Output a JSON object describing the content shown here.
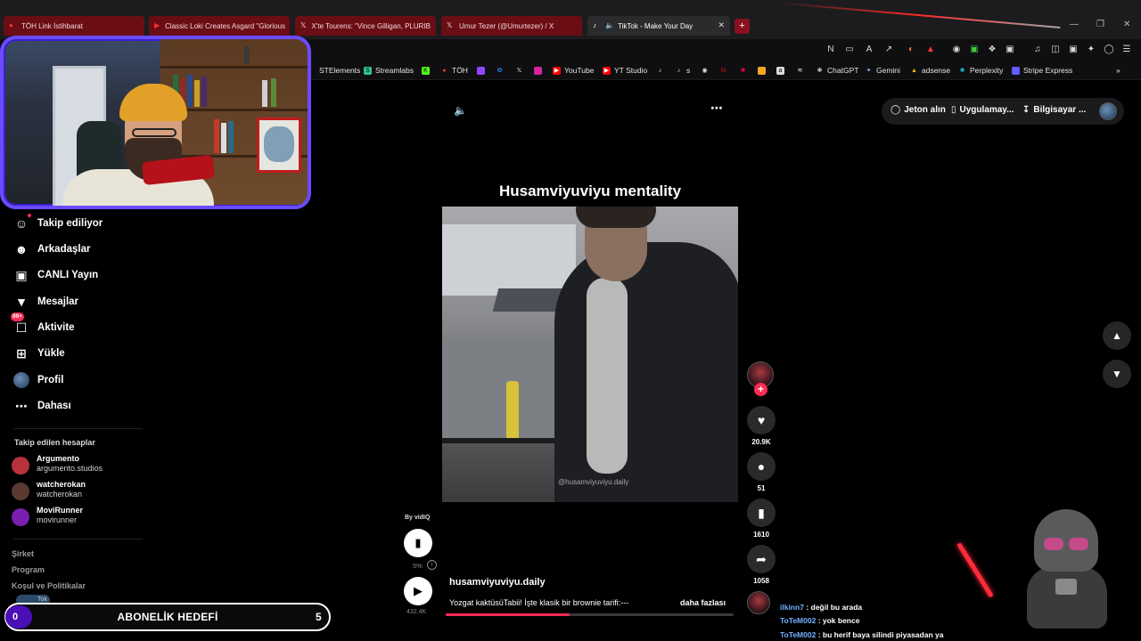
{
  "browser": {
    "tabs": [
      {
        "label": "TÖH Link İstihbarat",
        "icon": "tab-favicon"
      },
      {
        "label": "Classic Loki Creates Asgard \"Glorious",
        "icon": "youtube"
      },
      {
        "label": "X'te Tourens: \"Vince Gilligan, PLURIB",
        "icon": "x"
      },
      {
        "label": "Umur Tezer (@Umurtezer) / X",
        "icon": "x"
      },
      {
        "label": "TikTok - Make Your Day",
        "icon": "tiktok",
        "active": true
      }
    ],
    "bookmarks": [
      {
        "label": "STElements"
      },
      {
        "label": "Streamlabs"
      },
      {
        "label": ""
      },
      {
        "label": "TÖH"
      },
      {
        "label": ""
      },
      {
        "label": ""
      },
      {
        "label": ""
      },
      {
        "label": ""
      },
      {
        "label": "YouTube"
      },
      {
        "label": "YT Studio"
      },
      {
        "label": ""
      },
      {
        "label": "s"
      },
      {
        "label": ""
      },
      {
        "label": ""
      },
      {
        "label": ""
      },
      {
        "label": ""
      },
      {
        "label": ""
      },
      {
        "label": ""
      },
      {
        "label": "ChatGPT"
      },
      {
        "label": "Gemini"
      },
      {
        "label": "adsense"
      },
      {
        "label": "Perplexity"
      },
      {
        "label": "Stripe Express"
      }
    ]
  },
  "tiktok": {
    "header": {
      "coins": "Jeton alın",
      "app": "Uygulamay...",
      "desktop": "Bilgisayar ..."
    },
    "nav": [
      {
        "label": "Takip ediliyor",
        "icon": "following-icon"
      },
      {
        "label": "Arkadaşlar",
        "icon": "friends-icon"
      },
      {
        "label": "CANLI Yayın",
        "icon": "live-icon"
      },
      {
        "label": "Mesajlar",
        "icon": "messages-icon"
      },
      {
        "label": "Aktivite",
        "icon": "activity-icon",
        "badge": "99+"
      },
      {
        "label": "Yükle",
        "icon": "upload-icon"
      },
      {
        "label": "Profil",
        "icon": "profile-icon"
      },
      {
        "label": "Dahası",
        "icon": "more-icon"
      }
    ],
    "following_heading": "Takip edilen hesaplar",
    "following": [
      {
        "name": "Argumento",
        "handle": "argumento.studios",
        "color": "#b8323c"
      },
      {
        "name": "watcherokan",
        "handle": "watcherokan",
        "color": "#5a3a30"
      },
      {
        "name": "MoviRunner",
        "handle": "movirunner",
        "color": "#7a1fb0"
      }
    ],
    "footer": [
      "Şirket",
      "Program",
      "Koşul ve Politikalar"
    ],
    "footer_peek": "Tok",
    "video": {
      "title": "Husamviyuviyu mentality",
      "watermark": "@husamviyuviyu.daily",
      "by": "By vidIQ",
      "vidiq_percent": "5%",
      "views": "432.4K",
      "author": "husamviyuviyu.daily",
      "description": "Yozgat kaktüsüTabii! İşte klasik bir brownie tarifi:---",
      "more": "daha fazlası",
      "progress": 0.43
    },
    "actions": {
      "likes": "20.9K",
      "comments": "51",
      "saves": "1610",
      "shares": "1058"
    }
  },
  "overlay": {
    "goal": {
      "current": "0",
      "title": "ABONELİK HEDEFİ",
      "target": "5"
    },
    "chat": [
      {
        "user": "ilkinn7",
        "text": ": değil bu arada"
      },
      {
        "user": "ToTeM002",
        "text": ": yok bence"
      },
      {
        "user": "ToTeM002",
        "text": ": bu herif baya silindi piyasadan ya"
      }
    ]
  }
}
